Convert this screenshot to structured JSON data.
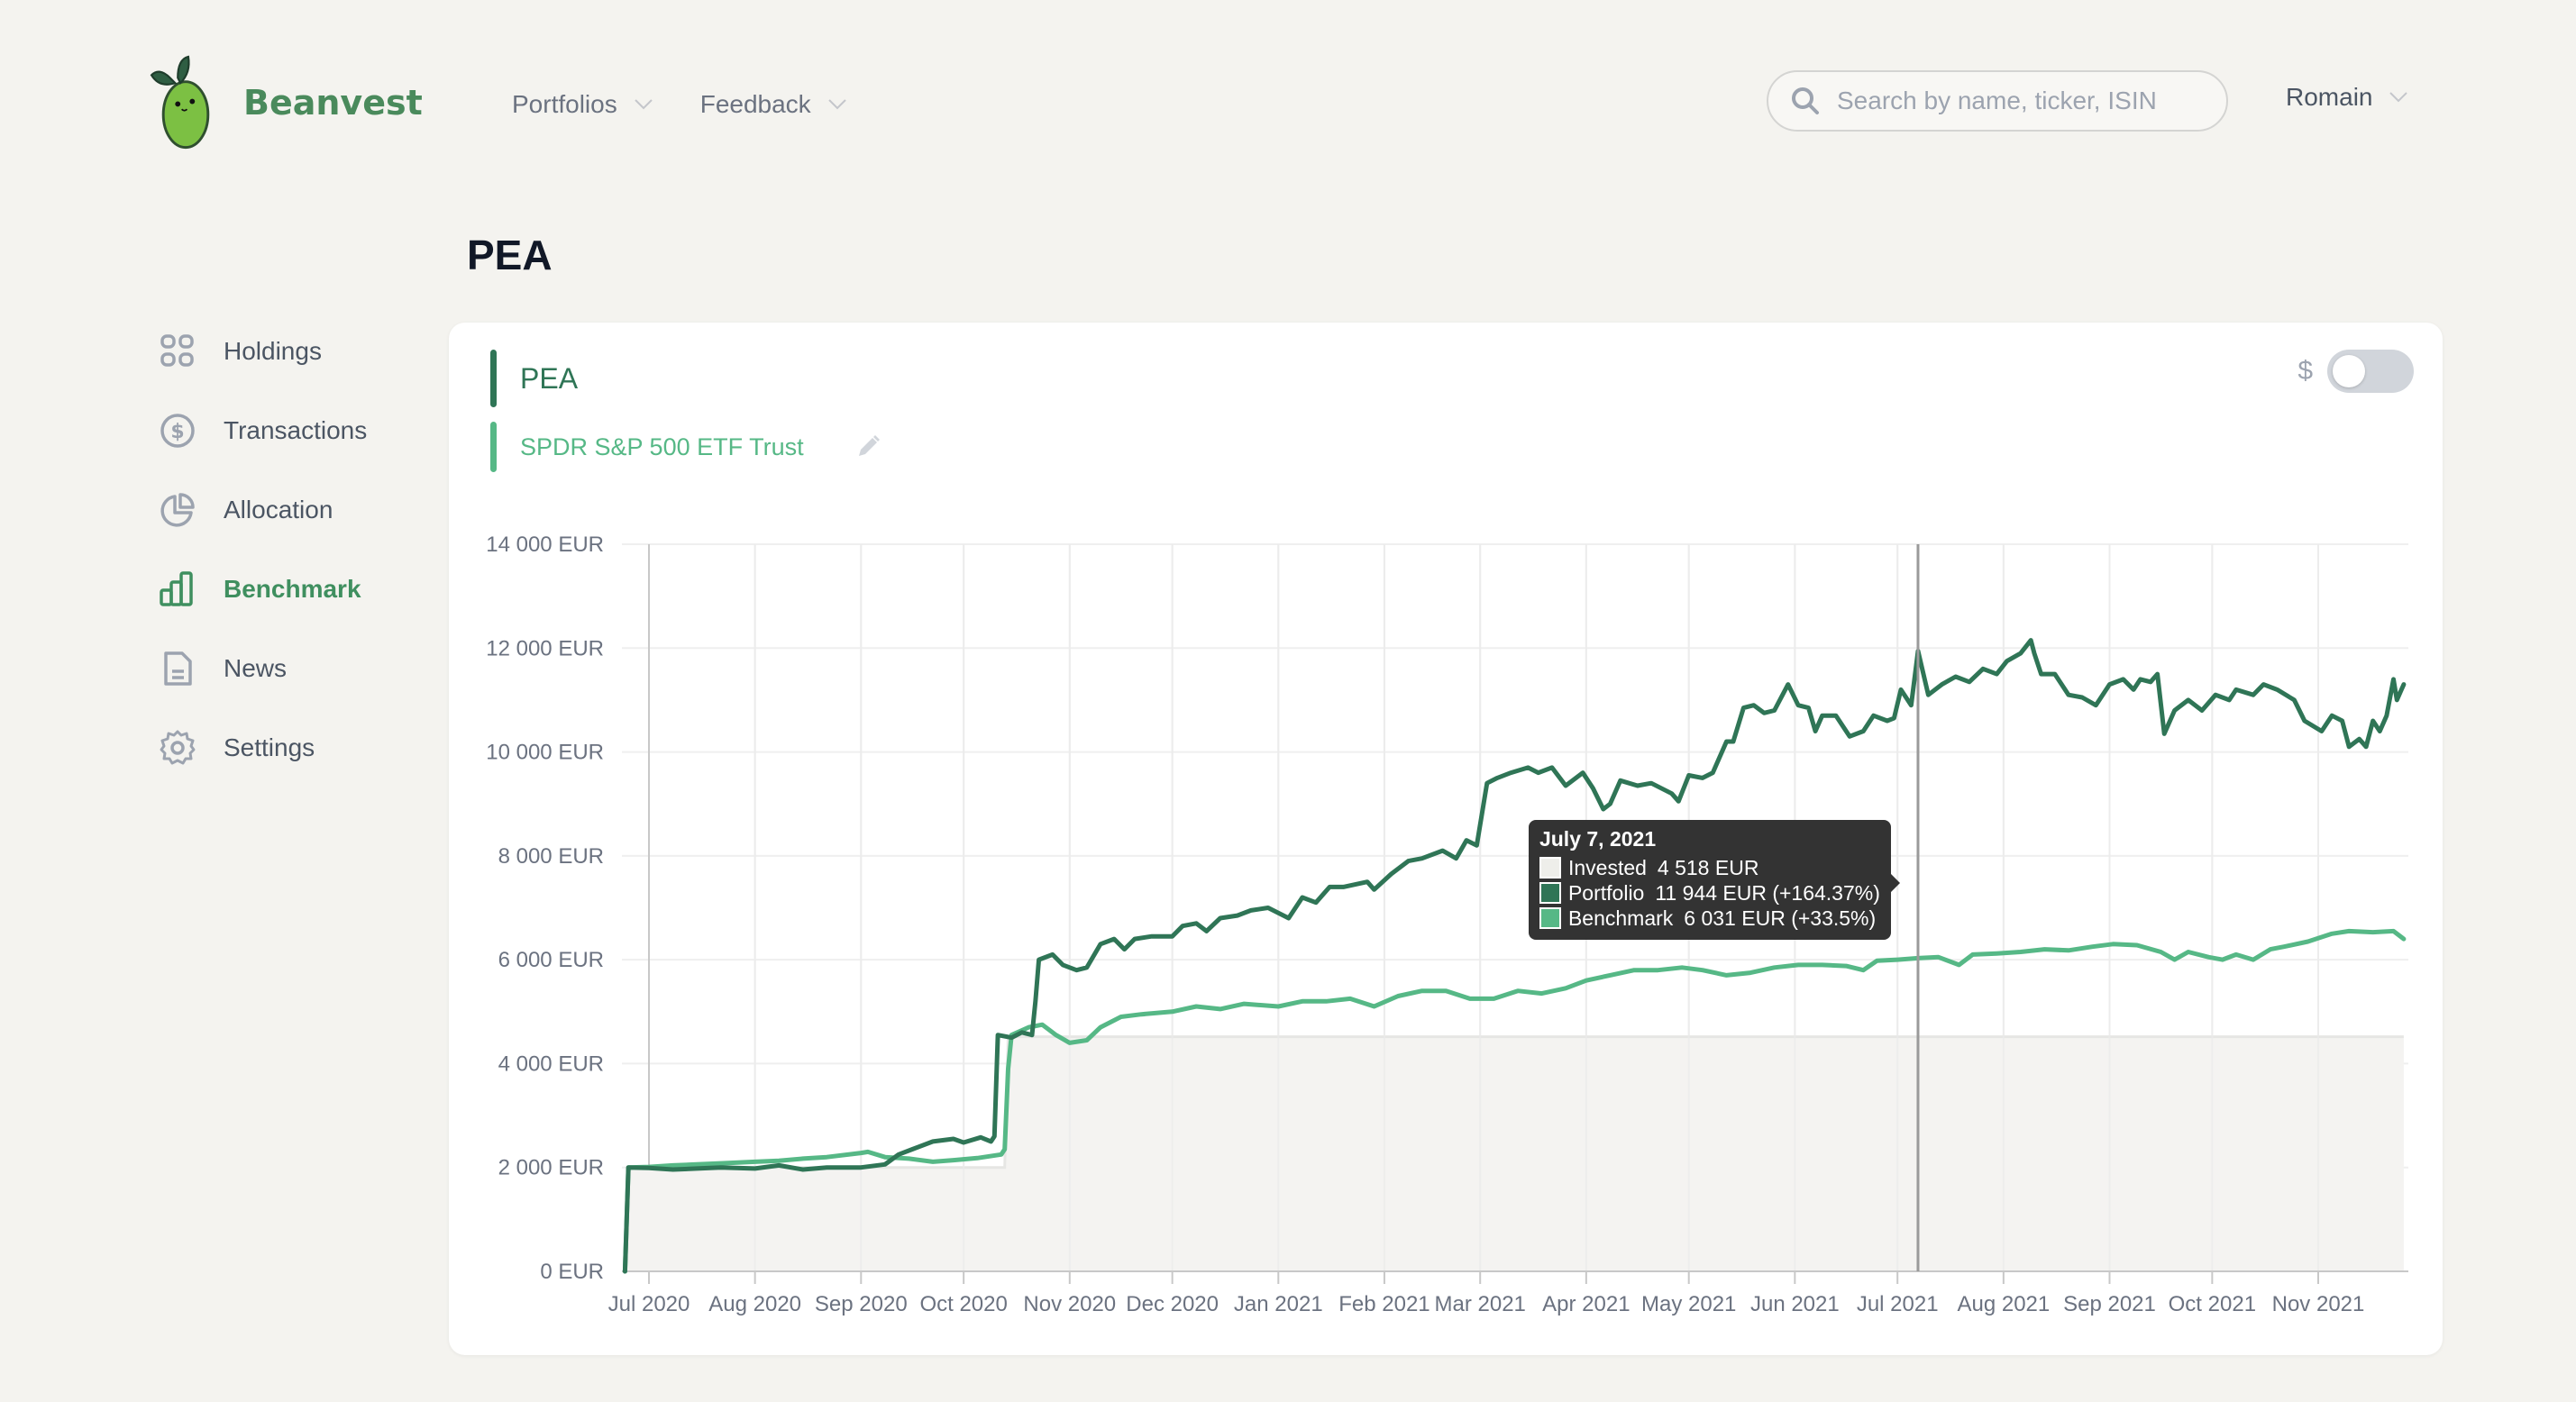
{
  "header": {
    "brand": "Beanvest",
    "nav": [
      {
        "label": "Portfolios"
      },
      {
        "label": "Feedback"
      }
    ],
    "search": {
      "placeholder": "Search by name, ticker, ISIN",
      "value": ""
    },
    "user": "Romain"
  },
  "sidebar": {
    "items": [
      {
        "label": "Holdings",
        "icon": "grid-icon",
        "active": false
      },
      {
        "label": "Transactions",
        "icon": "dollar-circle-icon",
        "active": false
      },
      {
        "label": "Allocation",
        "icon": "pie-chart-icon",
        "active": false
      },
      {
        "label": "Benchmark",
        "icon": "bar-chart-icon",
        "active": true
      },
      {
        "label": "News",
        "icon": "document-icon",
        "active": false
      },
      {
        "label": "Settings",
        "icon": "gear-icon",
        "active": false
      }
    ]
  },
  "page": {
    "title": "PEA"
  },
  "card": {
    "legend": {
      "portfolio": "PEA",
      "benchmark": "SPDR S&P 500 ETF Trust"
    },
    "currency_toggle": {
      "symbol": "$",
      "on": false
    }
  },
  "colors": {
    "portfolio": "#2f7556",
    "benchmark": "#56b886",
    "invested": "#f4f3f1",
    "accent": "#3f8f5f"
  },
  "tooltip": {
    "date": "July 7, 2021",
    "rows": [
      {
        "label": "Invested",
        "value": "4 518 EUR",
        "color": "#eeeeea"
      },
      {
        "label": "Portfolio",
        "value": "11 944 EUR (+164.37%)",
        "color": "#2f7556"
      },
      {
        "label": "Benchmark",
        "value": "6 031 EUR (+33.5%)",
        "color": "#56b886"
      }
    ]
  },
  "chart_data": {
    "type": "line",
    "title": "",
    "xlabel": "",
    "ylabel": "",
    "ylim": [
      0,
      14000
    ],
    "yticks": [
      0,
      2000,
      4000,
      6000,
      8000,
      10000,
      12000,
      14000
    ],
    "ytick_labels": [
      "0 EUR",
      "2 000 EUR",
      "4 000 EUR",
      "6 000 EUR",
      "8 000 EUR",
      "10 000 EUR",
      "12 000 EUR",
      "14 000 EUR"
    ],
    "xlim": [
      "2020-06-20",
      "2021-11-30"
    ],
    "xticks": [
      "2020-07-01",
      "2020-08-01",
      "2020-09-01",
      "2020-10-01",
      "2020-11-01",
      "2020-12-01",
      "2021-01-01",
      "2021-02-01",
      "2021-03-01",
      "2021-04-01",
      "2021-05-01",
      "2021-06-01",
      "2021-07-01",
      "2021-08-01",
      "2021-09-01",
      "2021-10-01",
      "2021-11-01"
    ],
    "xtick_labels": [
      "Jul 2020",
      "Aug 2020",
      "Sep 2020",
      "Oct 2020",
      "Nov 2020",
      "Dec 2020",
      "Jan 2021",
      "Feb 2021",
      "Mar 2021",
      "Apr 2021",
      "May 2021",
      "Jun 2021",
      "Jul 2021",
      "Aug 2021",
      "Sep 2021",
      "Oct 2021",
      "Nov 2021"
    ],
    "grid": true,
    "hover_date": "2021-07-07",
    "series": [
      {
        "name": "Invested",
        "kind": "area-step",
        "points": [
          [
            "2020-06-24",
            0
          ],
          [
            "2020-06-25",
            2000
          ],
          [
            "2020-10-13",
            2000
          ],
          [
            "2020-10-14",
            4518
          ],
          [
            "2021-11-26",
            4518
          ]
        ]
      },
      {
        "name": "Portfolio",
        "points": [
          [
            "2020-06-24",
            0
          ],
          [
            "2020-06-25",
            2000
          ],
          [
            "2020-07-01",
            1990
          ],
          [
            "2020-07-08",
            1960
          ],
          [
            "2020-07-15",
            1980
          ],
          [
            "2020-07-22",
            2000
          ],
          [
            "2020-08-01",
            1980
          ],
          [
            "2020-08-08",
            2040
          ],
          [
            "2020-08-15",
            1960
          ],
          [
            "2020-08-22",
            2000
          ],
          [
            "2020-09-01",
            2000
          ],
          [
            "2020-09-08",
            2060
          ],
          [
            "2020-09-12",
            2250
          ],
          [
            "2020-09-16",
            2350
          ],
          [
            "2020-09-22",
            2500
          ],
          [
            "2020-09-28",
            2550
          ],
          [
            "2020-10-01",
            2480
          ],
          [
            "2020-10-06",
            2580
          ],
          [
            "2020-10-09",
            2500
          ],
          [
            "2020-10-10",
            2600
          ],
          [
            "2020-10-11",
            4550
          ],
          [
            "2020-10-15",
            4500
          ],
          [
            "2020-10-18",
            4600
          ],
          [
            "2020-10-21",
            4550
          ],
          [
            "2020-10-22",
            5200
          ],
          [
            "2020-10-23",
            6000
          ],
          [
            "2020-10-27",
            6100
          ],
          [
            "2020-10-30",
            5900
          ],
          [
            "2020-11-03",
            5800
          ],
          [
            "2020-11-06",
            5850
          ],
          [
            "2020-11-10",
            6300
          ],
          [
            "2020-11-14",
            6400
          ],
          [
            "2020-11-17",
            6200
          ],
          [
            "2020-11-20",
            6400
          ],
          [
            "2020-11-25",
            6450
          ],
          [
            "2020-12-01",
            6450
          ],
          [
            "2020-12-04",
            6650
          ],
          [
            "2020-12-08",
            6700
          ],
          [
            "2020-12-11",
            6550
          ],
          [
            "2020-12-15",
            6800
          ],
          [
            "2020-12-20",
            6850
          ],
          [
            "2020-12-24",
            6950
          ],
          [
            "2020-12-29",
            7000
          ],
          [
            "2021-01-04",
            6800
          ],
          [
            "2021-01-08",
            7200
          ],
          [
            "2021-01-12",
            7100
          ],
          [
            "2021-01-16",
            7400
          ],
          [
            "2021-01-20",
            7400
          ],
          [
            "2021-01-27",
            7500
          ],
          [
            "2021-01-29",
            7350
          ],
          [
            "2021-02-03",
            7650
          ],
          [
            "2021-02-08",
            7900
          ],
          [
            "2021-02-12",
            7950
          ],
          [
            "2021-02-18",
            8100
          ],
          [
            "2021-02-22",
            7950
          ],
          [
            "2021-02-25",
            8300
          ],
          [
            "2021-02-28",
            8200
          ],
          [
            "2021-03-03",
            9400
          ],
          [
            "2021-03-06",
            9500
          ],
          [
            "2021-03-10",
            9600
          ],
          [
            "2021-03-15",
            9700
          ],
          [
            "2021-03-18",
            9600
          ],
          [
            "2021-03-22",
            9700
          ],
          [
            "2021-03-26",
            9350
          ],
          [
            "2021-03-31",
            9600
          ],
          [
            "2021-04-03",
            9300
          ],
          [
            "2021-04-06",
            8900
          ],
          [
            "2021-04-08",
            9000
          ],
          [
            "2021-04-11",
            9450
          ],
          [
            "2021-04-16",
            9350
          ],
          [
            "2021-04-20",
            9400
          ],
          [
            "2021-04-26",
            9200
          ],
          [
            "2021-04-28",
            9050
          ],
          [
            "2021-05-01",
            9550
          ],
          [
            "2021-05-05",
            9500
          ],
          [
            "2021-05-08",
            9600
          ],
          [
            "2021-05-12",
            10200
          ],
          [
            "2021-05-14",
            10200
          ],
          [
            "2021-05-17",
            10850
          ],
          [
            "2021-05-20",
            10900
          ],
          [
            "2021-05-23",
            10750
          ],
          [
            "2021-05-26",
            10800
          ],
          [
            "2021-05-30",
            11300
          ],
          [
            "2021-06-02",
            10900
          ],
          [
            "2021-06-05",
            10850
          ],
          [
            "2021-06-07",
            10400
          ],
          [
            "2021-06-09",
            10700
          ],
          [
            "2021-06-13",
            10700
          ],
          [
            "2021-06-17",
            10300
          ],
          [
            "2021-06-21",
            10400
          ],
          [
            "2021-06-24",
            10700
          ],
          [
            "2021-06-28",
            10600
          ],
          [
            "2021-06-30",
            10650
          ],
          [
            "2021-07-02",
            11200
          ],
          [
            "2021-07-05",
            10900
          ],
          [
            "2021-07-07",
            11944
          ],
          [
            "2021-07-10",
            11100
          ],
          [
            "2021-07-14",
            11300
          ],
          [
            "2021-07-18",
            11450
          ],
          [
            "2021-07-22",
            11350
          ],
          [
            "2021-07-26",
            11600
          ],
          [
            "2021-07-30",
            11500
          ],
          [
            "2021-08-02",
            11750
          ],
          [
            "2021-08-06",
            11900
          ],
          [
            "2021-08-09",
            12150
          ],
          [
            "2021-08-10",
            11900
          ],
          [
            "2021-08-12",
            11500
          ],
          [
            "2021-08-16",
            11500
          ],
          [
            "2021-08-20",
            11100
          ],
          [
            "2021-08-24",
            11050
          ],
          [
            "2021-08-28",
            10900
          ],
          [
            "2021-09-01",
            11300
          ],
          [
            "2021-09-05",
            11400
          ],
          [
            "2021-09-08",
            11200
          ],
          [
            "2021-09-10",
            11400
          ],
          [
            "2021-09-13",
            11350
          ],
          [
            "2021-09-15",
            11500
          ],
          [
            "2021-09-17",
            10350
          ],
          [
            "2021-09-20",
            10800
          ],
          [
            "2021-09-24",
            11000
          ],
          [
            "2021-09-28",
            10800
          ],
          [
            "2021-10-02",
            11100
          ],
          [
            "2021-10-06",
            11000
          ],
          [
            "2021-10-08",
            11200
          ],
          [
            "2021-10-13",
            11100
          ],
          [
            "2021-10-16",
            11300
          ],
          [
            "2021-10-20",
            11200
          ],
          [
            "2021-10-25",
            11000
          ],
          [
            "2021-10-28",
            10600
          ],
          [
            "2021-11-02",
            10400
          ],
          [
            "2021-11-05",
            10700
          ],
          [
            "2021-11-08",
            10600
          ],
          [
            "2021-11-10",
            10100
          ],
          [
            "2021-11-13",
            10250
          ],
          [
            "2021-11-15",
            10100
          ],
          [
            "2021-11-17",
            10600
          ],
          [
            "2021-11-19",
            10400
          ],
          [
            "2021-11-21",
            10700
          ],
          [
            "2021-11-23",
            11400
          ],
          [
            "2021-11-24",
            11000
          ],
          [
            "2021-11-26",
            11300
          ]
        ]
      },
      {
        "name": "Benchmark",
        "points": [
          [
            "2020-06-24",
            0
          ],
          [
            "2020-06-25",
            2000
          ],
          [
            "2020-07-01",
            2010
          ],
          [
            "2020-07-08",
            2040
          ],
          [
            "2020-07-15",
            2060
          ],
          [
            "2020-07-22",
            2080
          ],
          [
            "2020-08-01",
            2110
          ],
          [
            "2020-08-08",
            2130
          ],
          [
            "2020-08-15",
            2170
          ],
          [
            "2020-08-22",
            2200
          ],
          [
            "2020-09-01",
            2280
          ],
          [
            "2020-09-03",
            2300
          ],
          [
            "2020-09-08",
            2200
          ],
          [
            "2020-09-15",
            2170
          ],
          [
            "2020-09-22",
            2110
          ],
          [
            "2020-09-28",
            2140
          ],
          [
            "2020-10-05",
            2180
          ],
          [
            "2020-10-12",
            2250
          ],
          [
            "2020-10-13",
            2350
          ],
          [
            "2020-10-14",
            3900
          ],
          [
            "2020-10-15",
            4550
          ],
          [
            "2020-10-20",
            4700
          ],
          [
            "2020-10-24",
            4750
          ],
          [
            "2020-10-28",
            4550
          ],
          [
            "2020-11-01",
            4400
          ],
          [
            "2020-11-06",
            4450
          ],
          [
            "2020-11-10",
            4700
          ],
          [
            "2020-11-16",
            4900
          ],
          [
            "2020-11-22",
            4950
          ],
          [
            "2020-12-01",
            5000
          ],
          [
            "2020-12-08",
            5100
          ],
          [
            "2020-12-15",
            5050
          ],
          [
            "2020-12-22",
            5150
          ],
          [
            "2021-01-01",
            5100
          ],
          [
            "2021-01-08",
            5200
          ],
          [
            "2021-01-15",
            5200
          ],
          [
            "2021-01-22",
            5250
          ],
          [
            "2021-01-29",
            5100
          ],
          [
            "2021-02-05",
            5300
          ],
          [
            "2021-02-12",
            5400
          ],
          [
            "2021-02-19",
            5400
          ],
          [
            "2021-02-26",
            5250
          ],
          [
            "2021-03-05",
            5250
          ],
          [
            "2021-03-12",
            5400
          ],
          [
            "2021-03-19",
            5350
          ],
          [
            "2021-03-26",
            5450
          ],
          [
            "2021-04-01",
            5600
          ],
          [
            "2021-04-08",
            5700
          ],
          [
            "2021-04-15",
            5800
          ],
          [
            "2021-04-22",
            5800
          ],
          [
            "2021-04-29",
            5850
          ],
          [
            "2021-05-05",
            5800
          ],
          [
            "2021-05-12",
            5700
          ],
          [
            "2021-05-19",
            5750
          ],
          [
            "2021-05-26",
            5850
          ],
          [
            "2021-06-02",
            5900
          ],
          [
            "2021-06-09",
            5900
          ],
          [
            "2021-06-16",
            5880
          ],
          [
            "2021-06-21",
            5800
          ],
          [
            "2021-06-25",
            5980
          ],
          [
            "2021-07-01",
            6000
          ],
          [
            "2021-07-07",
            6031
          ],
          [
            "2021-07-13",
            6050
          ],
          [
            "2021-07-19",
            5900
          ],
          [
            "2021-07-23",
            6100
          ],
          [
            "2021-07-30",
            6120
          ],
          [
            "2021-08-06",
            6150
          ],
          [
            "2021-08-13",
            6200
          ],
          [
            "2021-08-20",
            6180
          ],
          [
            "2021-08-27",
            6250
          ],
          [
            "2021-09-02",
            6300
          ],
          [
            "2021-09-09",
            6280
          ],
          [
            "2021-09-16",
            6150
          ],
          [
            "2021-09-20",
            6000
          ],
          [
            "2021-09-24",
            6150
          ],
          [
            "2021-09-30",
            6050
          ],
          [
            "2021-10-04",
            6000
          ],
          [
            "2021-10-08",
            6100
          ],
          [
            "2021-10-13",
            6000
          ],
          [
            "2021-10-18",
            6200
          ],
          [
            "2021-10-22",
            6250
          ],
          [
            "2021-10-29",
            6350
          ],
          [
            "2021-11-05",
            6500
          ],
          [
            "2021-11-10",
            6550
          ],
          [
            "2021-11-17",
            6530
          ],
          [
            "2021-11-23",
            6550
          ],
          [
            "2021-11-26",
            6400
          ]
        ]
      }
    ]
  }
}
